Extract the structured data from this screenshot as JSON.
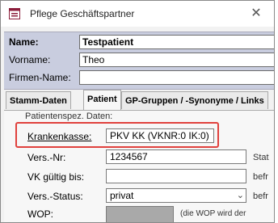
{
  "window": {
    "title": "Pflege Geschäftspartner",
    "close_glyph": "✕",
    "app_icon": "form-icon"
  },
  "header": {
    "name_label": "Name:",
    "name_value": "Testpatient",
    "vorname_label": "Vorname:",
    "vorname_value": "Theo",
    "firmenname_label": "Firmen-Name:",
    "firmenname_value": ""
  },
  "tabs": [
    {
      "label": "Stamm-Daten"
    },
    {
      "label": "Patient"
    },
    {
      "label": "GP-Gruppen / -Synonyme / Links"
    }
  ],
  "active_tab": "Patient",
  "patient": {
    "section_title": "Patientenspez. Daten:",
    "krankenkasse_label": "Krankenkasse:",
    "krankenkasse_value": "PKV KK (VKNR:0 IK:0)",
    "versnr_label": "Vers.-Nr:",
    "versnr_value": "1234567",
    "versnr_side": "Stat",
    "vk_label": "VK gültig bis:",
    "vk_value": "",
    "vk_side": "befr",
    "versstatus_label": "Vers.-Status:",
    "versstatus_value": "privat",
    "versstatus_side": "befr",
    "wop_label": "WOP:",
    "wop_note": "(die WOP wird der"
  },
  "colors": {
    "highlight_border": "#e0413d",
    "header_band": "#c9cddf"
  }
}
